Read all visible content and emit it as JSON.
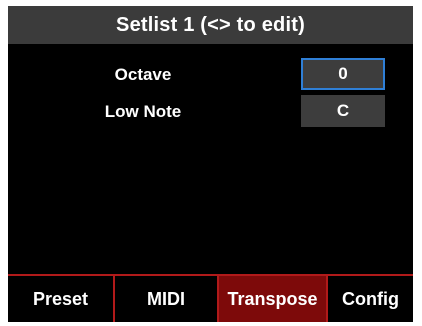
{
  "header": {
    "title": "Setlist 1 (<> to edit)"
  },
  "params": [
    {
      "label": "Octave",
      "value": "0",
      "selected": true
    },
    {
      "label": "Low Note",
      "value": "C",
      "selected": false
    }
  ],
  "tabs": [
    {
      "label": "Preset",
      "active": false
    },
    {
      "label": "MIDI",
      "active": false
    },
    {
      "label": "Transpose",
      "active": true
    },
    {
      "label": "Config",
      "active": false
    }
  ],
  "colors": {
    "title_bar": "#3b3b3b",
    "value_box": "#3d3d3d",
    "selection_border": "#2f7fd6",
    "tab_divider": "#b11a1a",
    "active_tab": "#7d0a0a"
  }
}
